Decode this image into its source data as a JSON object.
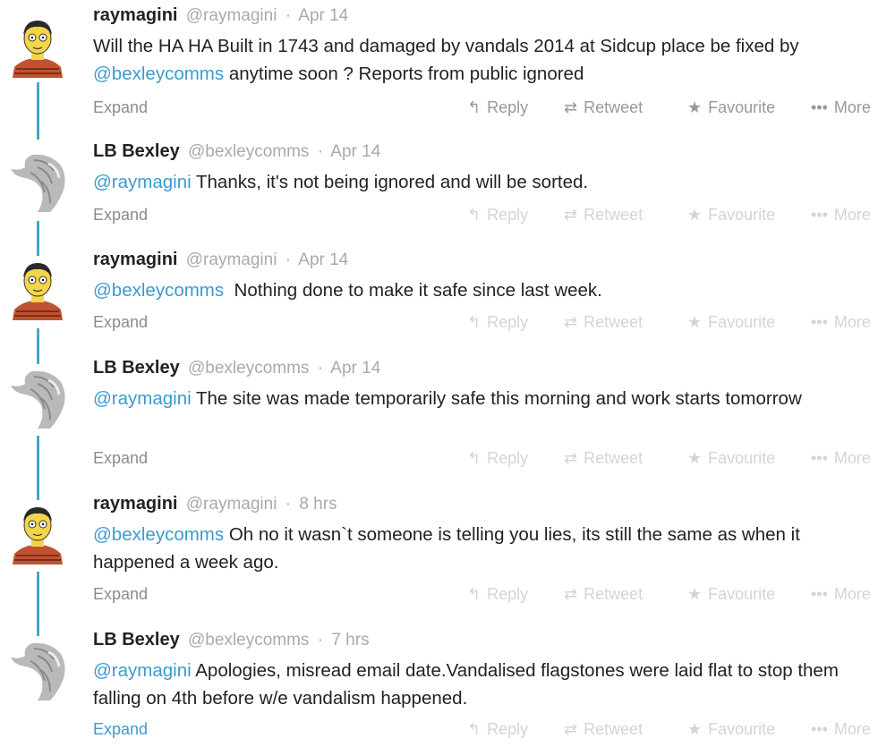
{
  "actions": {
    "reply": "Reply",
    "retweet": "Retweet",
    "favourite": "Favourite",
    "more": "More",
    "expand": "Expand"
  },
  "icons": {
    "reply": "reply-arrow-icon",
    "retweet": "retweet-icon",
    "favourite": "star-icon",
    "more": "ellipsis-icon"
  },
  "colors": {
    "mention": "#3b9bd0",
    "connector": "#47a8c2",
    "meta": "#aaaaaa"
  },
  "tweets": [
    {
      "author": "raymagini",
      "handle": "@raymagini",
      "time": "Apr 14",
      "mention": "",
      "text": "Will the HA HA Built in 1743 and damaged by vandals 2014 at Sidcup place be fixed by ",
      "mention_inline": "@bexleycomms",
      "text_after": " anytime soon ? Reports from public ignored"
    },
    {
      "author": "LB Bexley",
      "handle": "@bexleycomms",
      "time": "Apr 14",
      "mention": "@raymagini",
      "text": " Thanks, it's not being ignored and will be sorted."
    },
    {
      "author": "raymagini",
      "handle": "@raymagini",
      "time": "Apr 14",
      "mention": "@bexleycomms",
      "text": "  Nothing done to make it safe since last week."
    },
    {
      "author": "LB Bexley",
      "handle": "@bexleycomms",
      "time": "Apr 14",
      "mention": "@raymagini",
      "text": " The site was made temporarily safe this morning and work starts tomorrow"
    },
    {
      "author": "raymagini",
      "handle": "@raymagini",
      "time": "8 hrs",
      "mention": "@bexleycomms",
      "text": " Oh no it wasn`t someone is telling you lies, its still the same as when it happened a week ago."
    },
    {
      "author": "LB Bexley",
      "handle": "@bexleycomms",
      "time": "7 hrs",
      "mention": "@raymagini",
      "text": " Apologies, misread email date.Vandalised flagstones were laid flat to stop them falling on 4th before w/e vandalism happened."
    }
  ]
}
